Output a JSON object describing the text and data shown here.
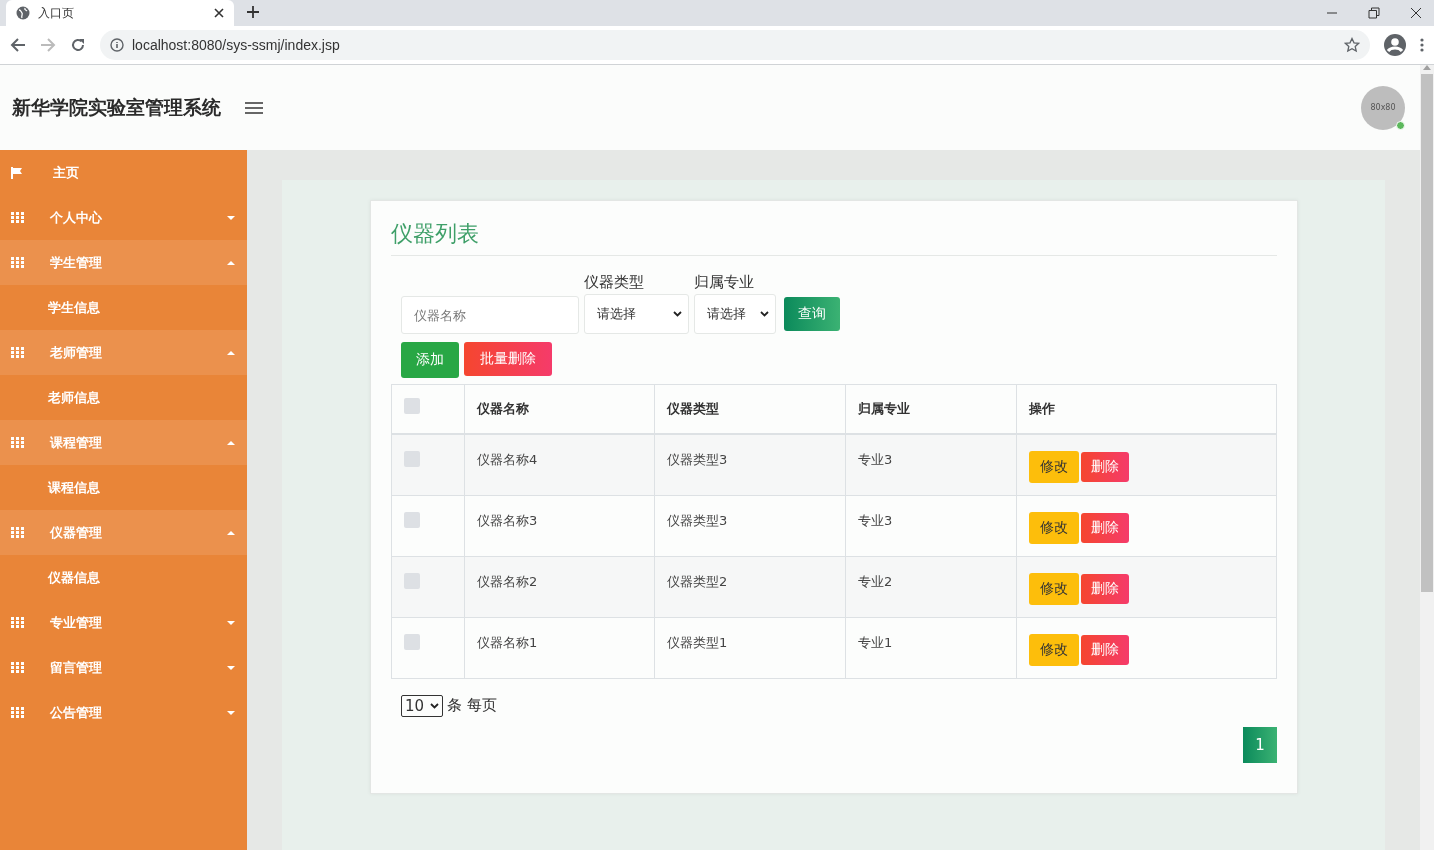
{
  "browser": {
    "tab_title": "入口页",
    "url": "localhost:8080/sys-ssmj/index.jsp"
  },
  "header": {
    "title": "新华学院实验室管理系统",
    "avatar_text": "80x80",
    "online": true
  },
  "sidebar": {
    "items": [
      {
        "kind": "link",
        "label": "主页",
        "expanded": false
      },
      {
        "kind": "group",
        "label": "个人中心",
        "expanded": false
      },
      {
        "kind": "group",
        "label": "学生管理",
        "expanded": true,
        "children": [
          {
            "label": "学生信息"
          }
        ]
      },
      {
        "kind": "group",
        "label": "老师管理",
        "expanded": true,
        "children": [
          {
            "label": "老师信息"
          }
        ]
      },
      {
        "kind": "group",
        "label": "课程管理",
        "expanded": true,
        "children": [
          {
            "label": "课程信息"
          }
        ]
      },
      {
        "kind": "group",
        "label": "仪器管理",
        "expanded": true,
        "children": [
          {
            "label": "仪器信息"
          }
        ]
      },
      {
        "kind": "group",
        "label": "专业管理",
        "expanded": false
      },
      {
        "kind": "group",
        "label": "留言管理",
        "expanded": false
      },
      {
        "kind": "group",
        "label": "公告管理",
        "expanded": false
      }
    ]
  },
  "card": {
    "title": "仪器列表",
    "filters": [
      {
        "kind": "input",
        "placeholder": "仪器名称"
      },
      {
        "kind": "select",
        "label": "仪器类型",
        "value": "请选择"
      },
      {
        "kind": "select",
        "label": "归属专业",
        "value": "请选择"
      }
    ],
    "search_button": "查询",
    "add_button": "添加",
    "batch_delete_button": "批量删除",
    "table": {
      "columns": [
        "仪器名称",
        "仪器类型",
        "归属专业",
        "操作"
      ],
      "header_checked": false,
      "rows": [
        {
          "checked": false,
          "cells": [
            "仪器名称4",
            "仪器类型3",
            "专业3"
          ],
          "actions": [
            "修改",
            "删除"
          ]
        },
        {
          "checked": false,
          "cells": [
            "仪器名称3",
            "仪器类型3",
            "专业3"
          ],
          "actions": [
            "修改",
            "删除"
          ]
        },
        {
          "checked": false,
          "cells": [
            "仪器名称2",
            "仪器类型2",
            "专业2"
          ],
          "actions": [
            "修改",
            "删除"
          ]
        },
        {
          "checked": false,
          "cells": [
            "仪器名称1",
            "仪器类型1",
            "专业1"
          ],
          "actions": [
            "修改",
            "删除"
          ]
        }
      ]
    },
    "page_size": "10",
    "page_size_label": "条 每页",
    "pages": [
      {
        "label": "1",
        "selected": true
      }
    ]
  }
}
